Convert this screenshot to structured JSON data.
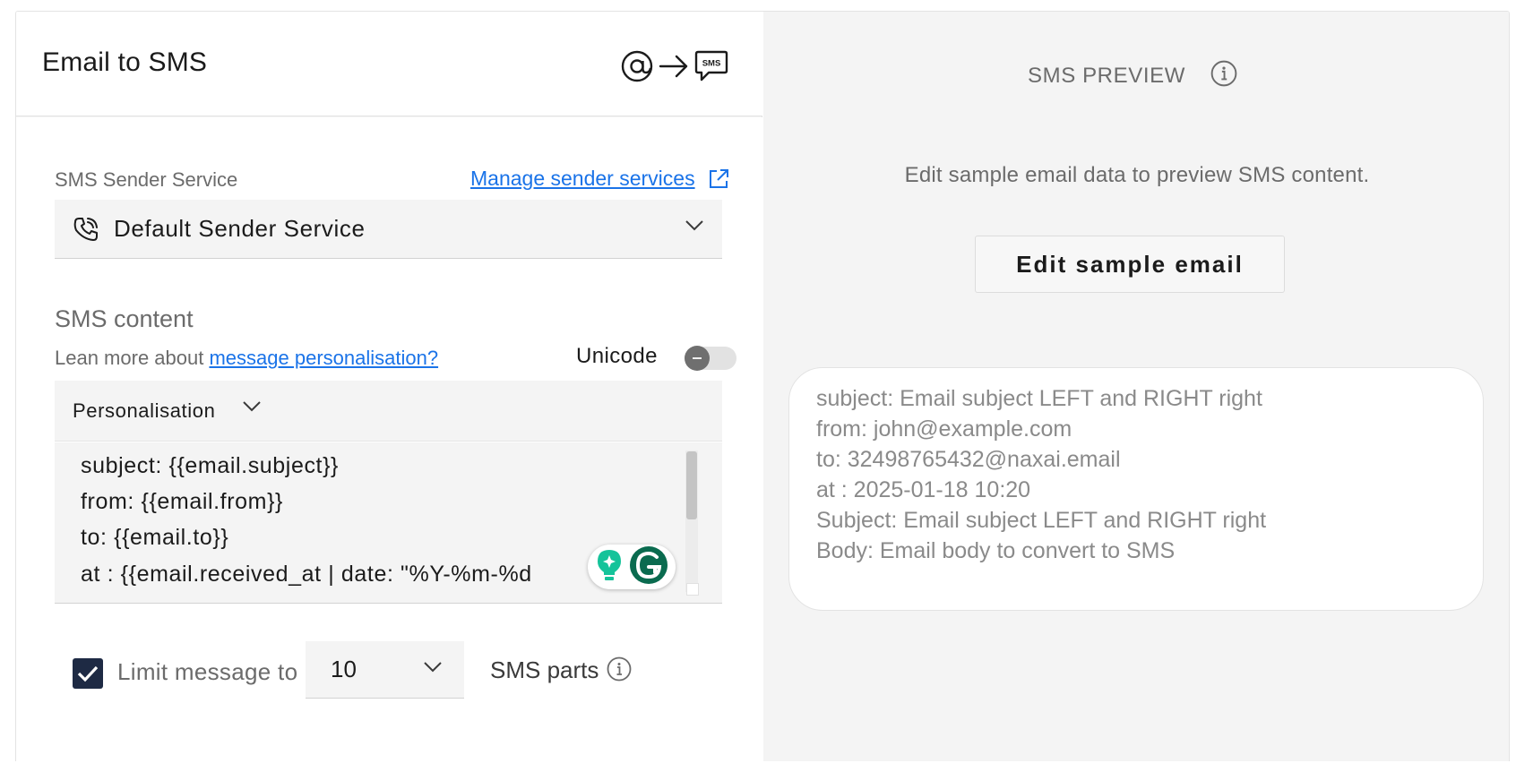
{
  "left_panel": {
    "title": "Email to SMS",
    "header_icons": [
      "at-sign-icon",
      "arrow-right-icon",
      "sms-bubble-icon"
    ],
    "sms_icon_text": "SMS",
    "sender": {
      "label": "SMS Sender Service",
      "manage_link": "Manage sender services",
      "selected_value": "Default Sender Service"
    },
    "content": {
      "title": "SMS content",
      "learn_prefix": "Lean more about",
      "learn_link": "message personalisation?",
      "unicode_label": "Unicode",
      "unicode_enabled": false,
      "personalisation_label": "Personalisation",
      "editor_lines": [
        "subject: {{email.subject}}",
        "from: {{email.from}}",
        "to: {{email.to}}",
        "at : {{email.received_at | date: \"%Y-%m-%d"
      ]
    },
    "limit": {
      "checked": true,
      "label": "Limit message to",
      "parts_value": "10",
      "parts_label": "SMS parts"
    }
  },
  "right_panel": {
    "title": "SMS PREVIEW",
    "hint": "Edit sample email data to preview SMS content.",
    "edit_button": "Edit sample email",
    "preview_lines": [
      "subject: Email subject LEFT and RIGHT right",
      "from: john@example.com",
      "to: 32498765432@naxai.email",
      "at : 2025-01-18 10:20",
      "Subject: Email subject LEFT and RIGHT right",
      "Body: Email body to convert to SMS"
    ]
  },
  "colors": {
    "link": "#1a73e8",
    "checkbox": "#1e2a44",
    "grammarly_green": "#15c39a",
    "grammarly_dark": "#0a6b4f",
    "panel_bg": "#f4f4f4"
  }
}
